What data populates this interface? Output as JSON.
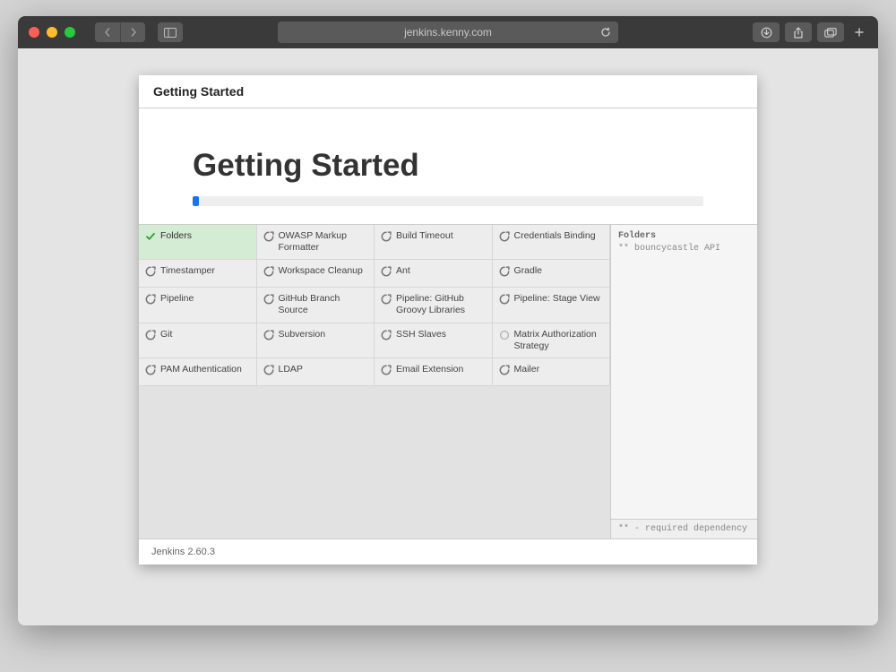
{
  "browser": {
    "url": "jenkins.kenny.com"
  },
  "wizard": {
    "breadcrumb": "Getting Started",
    "title": "Getting Started",
    "progress_percent": 1.2,
    "footer_version": "Jenkins 2.60.3"
  },
  "plugins": [
    {
      "name": "Folders",
      "status": "done"
    },
    {
      "name": "OWASP Markup Formatter",
      "status": "pending"
    },
    {
      "name": "Build Timeout",
      "status": "pending"
    },
    {
      "name": "Credentials Binding",
      "status": "pending"
    },
    {
      "name": "Timestamper",
      "status": "pending"
    },
    {
      "name": "Workspace Cleanup",
      "status": "pending"
    },
    {
      "name": "Ant",
      "status": "pending"
    },
    {
      "name": "Gradle",
      "status": "pending"
    },
    {
      "name": "Pipeline",
      "status": "pending"
    },
    {
      "name": "GitHub Branch Source",
      "status": "pending"
    },
    {
      "name": "Pipeline: GitHub Groovy Libraries",
      "status": "pending"
    },
    {
      "name": "Pipeline: Stage View",
      "status": "pending"
    },
    {
      "name": "Git",
      "status": "pending"
    },
    {
      "name": "Subversion",
      "status": "pending"
    },
    {
      "name": "SSH Slaves",
      "status": "pending"
    },
    {
      "name": "Matrix Authorization Strategy",
      "status": "active"
    },
    {
      "name": "PAM Authentication",
      "status": "pending"
    },
    {
      "name": "LDAP",
      "status": "pending"
    },
    {
      "name": "Email Extension",
      "status": "pending"
    },
    {
      "name": "Mailer",
      "status": "pending"
    }
  ],
  "log": {
    "heading": "Folders",
    "line1": "** bouncycastle API",
    "footnote": "** - required dependency"
  }
}
